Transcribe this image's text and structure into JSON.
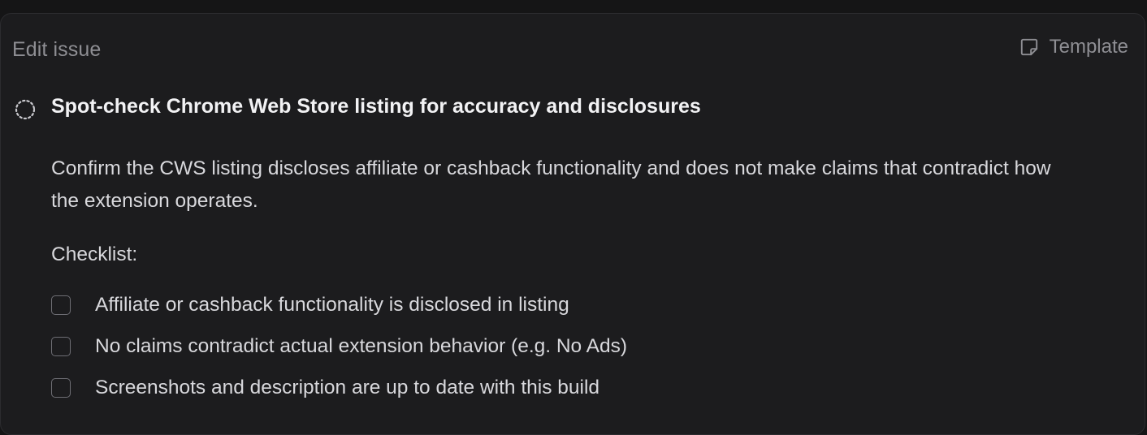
{
  "header": {
    "title": "Edit issue",
    "template_label": "Template",
    "template_icon": "sticky-note-icon"
  },
  "issue": {
    "status_icon": "dashed-circle-icon",
    "title": "Spot-check Chrome Web Store listing for accuracy and disclosures",
    "description": "Confirm the CWS listing discloses affiliate or cashback functionality and does not make claims that contradict how the extension operates.",
    "checklist_label": "Checklist:",
    "checklist": [
      {
        "label": "Affiliate or cashback functionality is disclosed in listing",
        "checked": false
      },
      {
        "label": "No claims contradict actual extension behavior (e.g. No Ads)",
        "checked": false
      },
      {
        "label": "Screenshots and description are up to date with this build",
        "checked": false
      }
    ]
  },
  "colors": {
    "background": "#151516",
    "panel": "#1c1c1e",
    "muted_text": "#8e8e93",
    "primary_text": "#f2f2f4"
  }
}
